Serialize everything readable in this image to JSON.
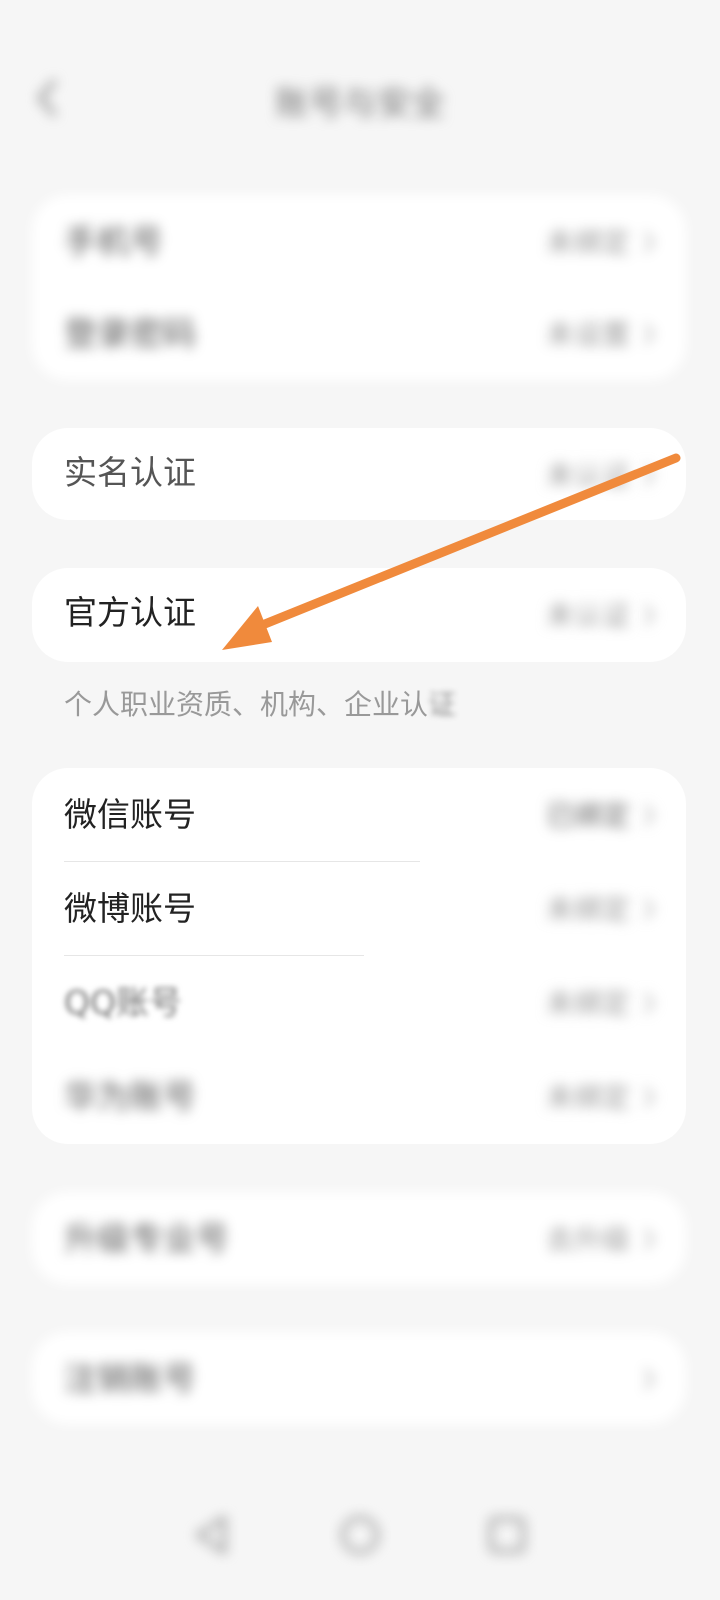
{
  "header": {
    "back_icon": "chevron-left-icon",
    "title": "账号与安全"
  },
  "group1": [
    {
      "label": "手机号",
      "value": "未绑定"
    },
    {
      "label": "登录密码",
      "value": "未设置"
    }
  ],
  "realname": {
    "label": "实名认证",
    "value": "未认证"
  },
  "official": {
    "label": "官方认证",
    "value": "未认证"
  },
  "official_note": {
    "visible": "个人职业资质、机构、企业认",
    "faded": "证"
  },
  "accounts": [
    {
      "label": "微信账号",
      "value": "已绑定"
    },
    {
      "label": "微博账号",
      "value": "未绑定"
    },
    {
      "label": "QQ账号",
      "value": "未绑定"
    },
    {
      "label": "华为账号",
      "value": "未绑定"
    }
  ],
  "upgrade": {
    "label": "升级专业号",
    "value": "去升级"
  },
  "cancel_account": {
    "label": "注销账号"
  },
  "arrow_color": "#f08a3c",
  "nav": [
    "back-nav-icon",
    "home-nav-icon",
    "recents-nav-icon"
  ]
}
